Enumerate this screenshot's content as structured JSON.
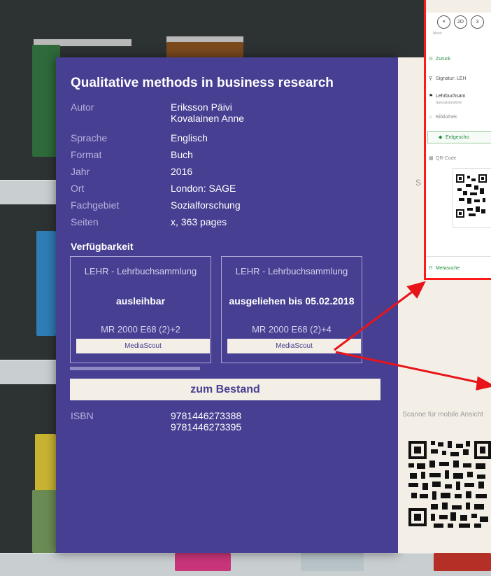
{
  "book": {
    "title": "Qualitative methods in business research",
    "fields": [
      {
        "label": "Autor",
        "value": "Eriksson Päivi",
        "value2": "Kovalainen Anne"
      },
      {
        "label": "Sprache",
        "value": "Englisch"
      },
      {
        "label": "Format",
        "value": "Buch"
      },
      {
        "label": "Jahr",
        "value": "2016"
      },
      {
        "label": "Ort",
        "value": "London: SAGE"
      },
      {
        "label": "Fachgebiet",
        "value": "Sozialforschung"
      },
      {
        "label": "Seiten",
        "value": "x, 363 pages"
      }
    ],
    "availability_title": "Verfügbarkeit",
    "copies": [
      {
        "location": "LEHR - Lehrbuchsammlung",
        "status": "ausleihbar",
        "signature": "MR 2000 E68 (2)+2",
        "button": "MediaScout"
      },
      {
        "location": "LEHR - Lehrbuchsammlung",
        "status": "ausgeliehen bis 05.02.2018",
        "signature": "MR 2000 E68 (2)+4",
        "button": "MediaScout"
      }
    ],
    "bestand_button": "zum Bestand",
    "isbn_label": "ISBN",
    "isbn": [
      "9781446273388",
      "9781446273395"
    ]
  },
  "sidebar": {
    "scan_text": "Scanne für mobile Ansicht",
    "partial_letter": "S"
  },
  "mobile": {
    "buttons": [
      "≡",
      "2D",
      "3"
    ],
    "menu_label": "Menü",
    "items": {
      "back": "Zurück",
      "signature": "Signatur: LEH",
      "lehrbuch": "Lehrbuchsam",
      "spezial": "Spezialstandorte",
      "library": "Bibliothek",
      "floor": "Erdgescho",
      "qr": "QR-Code",
      "meta": "Metasuche"
    }
  },
  "colors": {
    "panel": "#473f92",
    "cream": "#f4efe6",
    "annotation": "#ff1a1a",
    "accent_green": "#1f8a3a"
  }
}
